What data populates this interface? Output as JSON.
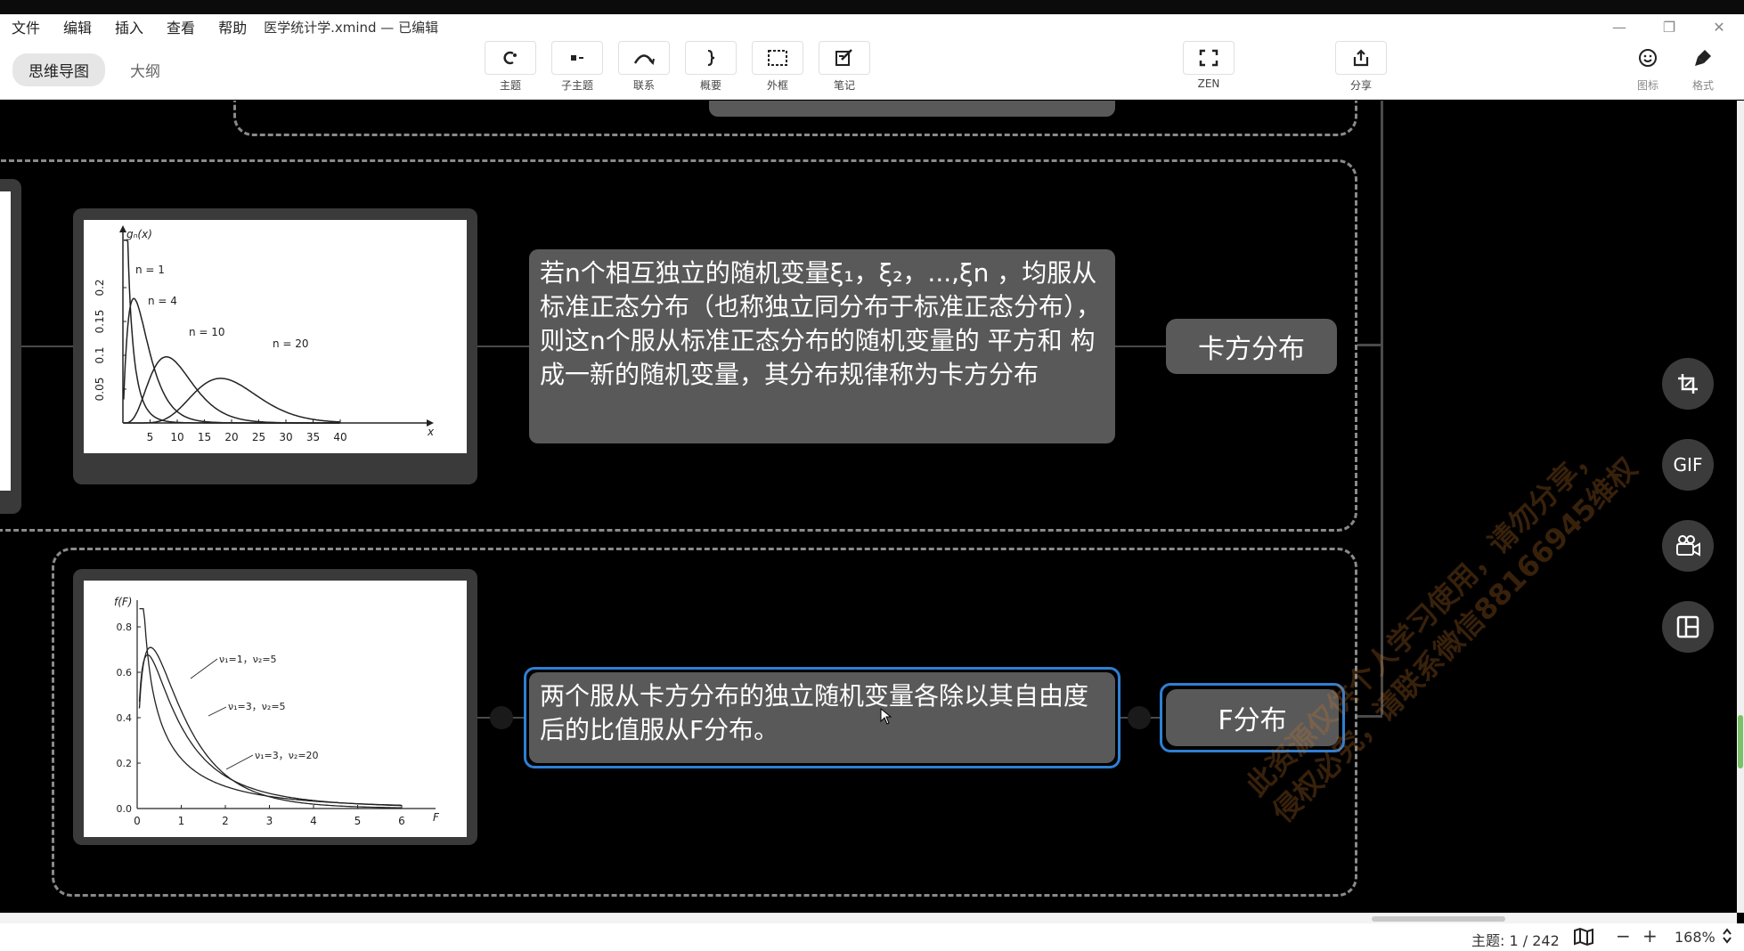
{
  "menubar": {
    "items": [
      "文件",
      "编辑",
      "插入",
      "查看",
      "帮助"
    ],
    "doc_title": "医学统计学.xmind  — 已编辑",
    "window_controls": [
      "—",
      "❐",
      "✕"
    ]
  },
  "toolbar": {
    "view_tabs": [
      "思维导图",
      "大纲"
    ],
    "tools": [
      "主题",
      "子主题",
      "联系",
      "概要",
      "外框",
      "笔记"
    ],
    "zen": "ZEN",
    "share": "分享",
    "icons_label": "图标",
    "format_label": "格式"
  },
  "nodes": {
    "chi_square_desc": "若n个相互独立的随机变量ξ₁，ξ₂，...,ξn ，均服从标准正态分布（也称独立同分布于标准正态分布），则这n个服从标准正态分布的随机变量的 平方和 构成一新的随机变量，其分布规律称为卡方分布",
    "chi_square_topic": "卡方分布",
    "f_desc": "两个服从卡方分布的独立随机变量各除以其自由度后的比值服从F分布。",
    "f_topic": "F分布"
  },
  "chart_data": [
    {
      "type": "line",
      "ylabel": "gₙ(x)",
      "xlabel": "x",
      "x_ticks": [
        5,
        10,
        15,
        20,
        25,
        30,
        35,
        40
      ],
      "y_ticks": [
        0.05,
        0.1,
        0.15,
        0.2
      ],
      "series_labels": [
        "n = 1",
        "n = 4",
        "n = 10",
        "n = 20"
      ]
    },
    {
      "type": "line",
      "ylabel": "f(F)",
      "xlabel": "F",
      "x_ticks": [
        0,
        1,
        2,
        3,
        4,
        5,
        6
      ],
      "y_ticks": [
        0.0,
        0.2,
        0.4,
        0.6,
        0.8
      ],
      "series_labels": [
        "ν₁=1，ν₂=5",
        "ν₁=3，ν₂=5",
        "ν₁=3，ν₂=20"
      ]
    }
  ],
  "side_panel": {
    "buttons": [
      "crop-icon",
      "GIF",
      "video-icon",
      "layout-icon"
    ],
    "gif_label": "GIF"
  },
  "watermark": {
    "line1": "此资源仅供个人学习使用，请勿分享，",
    "line2": "侵权必究，请联系微信88166945维权"
  },
  "statusbar": {
    "topic_count": "主题: 1 / 242",
    "zoom": "168%",
    "minus": "−",
    "plus": "+"
  }
}
